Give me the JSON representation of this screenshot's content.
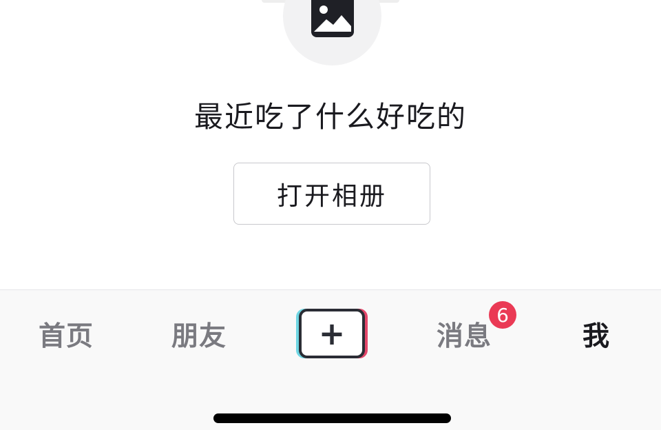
{
  "gallery": {
    "icon": "image-icon"
  },
  "prompt": {
    "text": "最近吃了什么好吃的"
  },
  "open_album_button": {
    "label": "打开相册"
  },
  "tabbar": {
    "home_label": "首页",
    "friends_label": "朋友",
    "create_icon": "plus-icon",
    "messages_label": "消息",
    "messages_badge": "6",
    "me_label": "我",
    "active_tab": "我"
  },
  "colors": {
    "badge": "#ea3a55",
    "create_cyan": "#6fd6e3",
    "create_pink": "#e4476a",
    "active_tab_text": "#1a1a1f",
    "inactive_tab_text": "#7a7a80"
  }
}
